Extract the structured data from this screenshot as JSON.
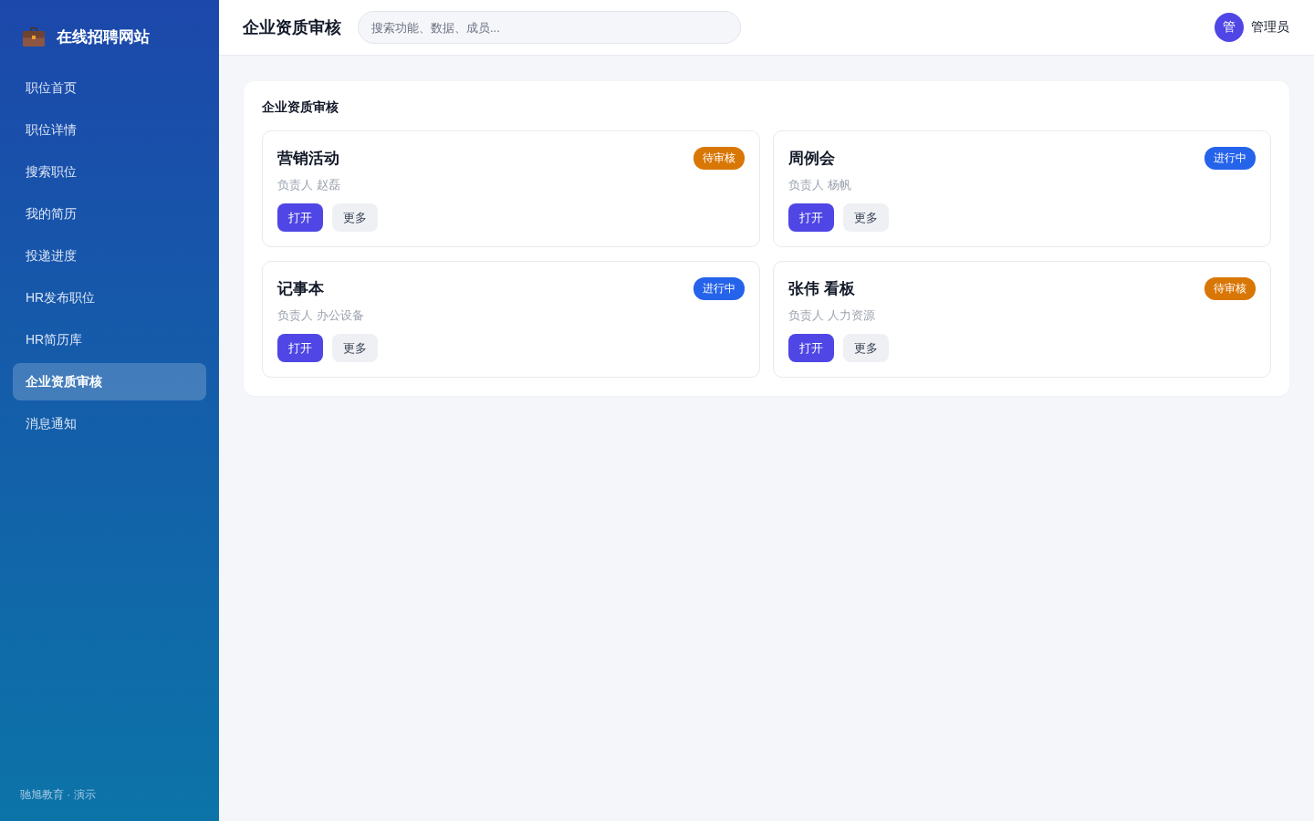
{
  "sidebar": {
    "brand": "在线招聘网站",
    "items": [
      {
        "label": "职位首页",
        "selected": false
      },
      {
        "label": "职位详情",
        "selected": false
      },
      {
        "label": "搜索职位",
        "selected": false
      },
      {
        "label": "我的简历",
        "selected": false
      },
      {
        "label": "投递进度",
        "selected": false
      },
      {
        "label": "HR发布职位",
        "selected": false
      },
      {
        "label": "HR简历库",
        "selected": false
      },
      {
        "label": "企业资质审核",
        "selected": true
      },
      {
        "label": "消息通知",
        "selected": false
      }
    ],
    "footer": "驰旭教育 · 演示"
  },
  "header": {
    "title": "企业资质审核",
    "search": {
      "placeholder": "搜索功能、数据、成员..."
    },
    "user": {
      "avatar": "管",
      "name": "管理员"
    }
  },
  "panel": {
    "title": "企业资质审核",
    "cards": [
      {
        "title": "营销活动",
        "badge": {
          "text": "待审核",
          "color": "#d97706"
        },
        "owner": "负责人 赵磊",
        "actions": [
          {
            "label": "打开",
            "kind": "primary"
          },
          {
            "label": "更多",
            "kind": "secondary"
          }
        ]
      },
      {
        "title": "周例会",
        "badge": {
          "text": "进行中",
          "color": "#2563eb"
        },
        "owner": "负责人 杨帆",
        "actions": [
          {
            "label": "打开",
            "kind": "primary"
          },
          {
            "label": "更多",
            "kind": "secondary"
          }
        ]
      },
      {
        "title": "记事本",
        "badge": {
          "text": "进行中",
          "color": "#2563eb"
        },
        "owner": "负责人 办公设备",
        "actions": [
          {
            "label": "打开",
            "kind": "primary"
          },
          {
            "label": "更多",
            "kind": "secondary"
          }
        ]
      },
      {
        "title": "张伟 看板",
        "badge": {
          "text": "待审核",
          "color": "#d97706"
        },
        "owner": "负责人 人力资源",
        "actions": [
          {
            "label": "打开",
            "kind": "primary"
          },
          {
            "label": "更多",
            "kind": "secondary"
          }
        ]
      }
    ]
  }
}
